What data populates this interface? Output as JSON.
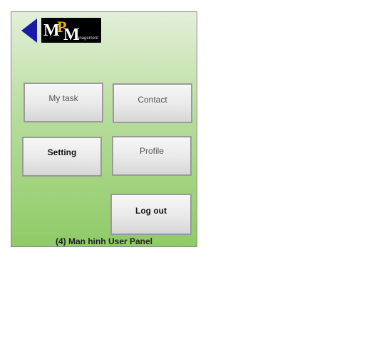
{
  "logo": {
    "letters": "MPM",
    "tagline": "anagement"
  },
  "buttons": {
    "my_task": "My task",
    "contact": "Contact",
    "setting": "Setting",
    "profile": "Profile",
    "log_out": "Log out"
  },
  "caption": "(4) Man hinh User Panel",
  "colors": {
    "back_arrow": "#1a1aa6",
    "panel_top": "#e3efd9",
    "panel_bottom": "#8fcb66",
    "logo_accent": "#f0b400"
  },
  "icons": {
    "back": "back-arrow-icon"
  }
}
